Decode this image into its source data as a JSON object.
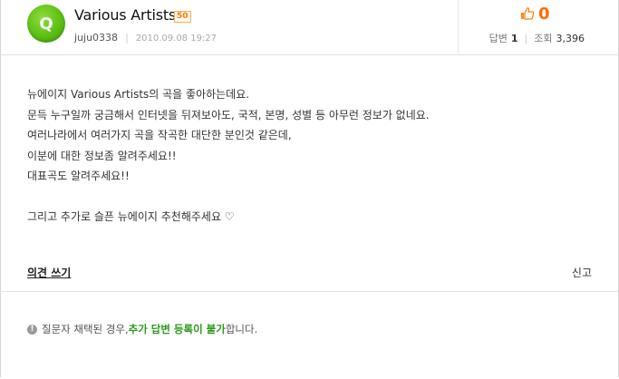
{
  "question": {
    "title": "Various Artists",
    "level_badge": "50",
    "avatar_letter": "Q",
    "author": "juju0338",
    "date": "2010.09.08 19:27",
    "likes": "0",
    "answers_label": "답변",
    "answers_count": "1",
    "views_label": "조회",
    "views_count": "3,396"
  },
  "body": {
    "lines": [
      "뉴에이지 Various Artists의 곡을 좋아하는데요.",
      "문득 누구일까 궁금해서 인터넷을 뒤져보아도, 국적, 본명, 성별 등 아무런 정보가 없네요.",
      "여러나라에서 여러가지 곡을 작곡한 대단한 분인것 같은데,",
      "이분에 대한 정보좀 알려주세요!!",
      "대표곡도 알려주세요!!",
      "그리고 추가로 슬픈 뉴에이지 추천해주세요 ♡"
    ]
  },
  "actions": {
    "opinion_label": "의견 쓰기",
    "report_label": "신고"
  },
  "notice": {
    "prefix": "질문자 채택된 경우, ",
    "highlight": "추가 답변 등록이 불가",
    "suffix": "합니다."
  },
  "colors": {
    "accent": "#ff6a00",
    "avatar": "#5bbf14",
    "highlight": "#2f9a1d"
  }
}
